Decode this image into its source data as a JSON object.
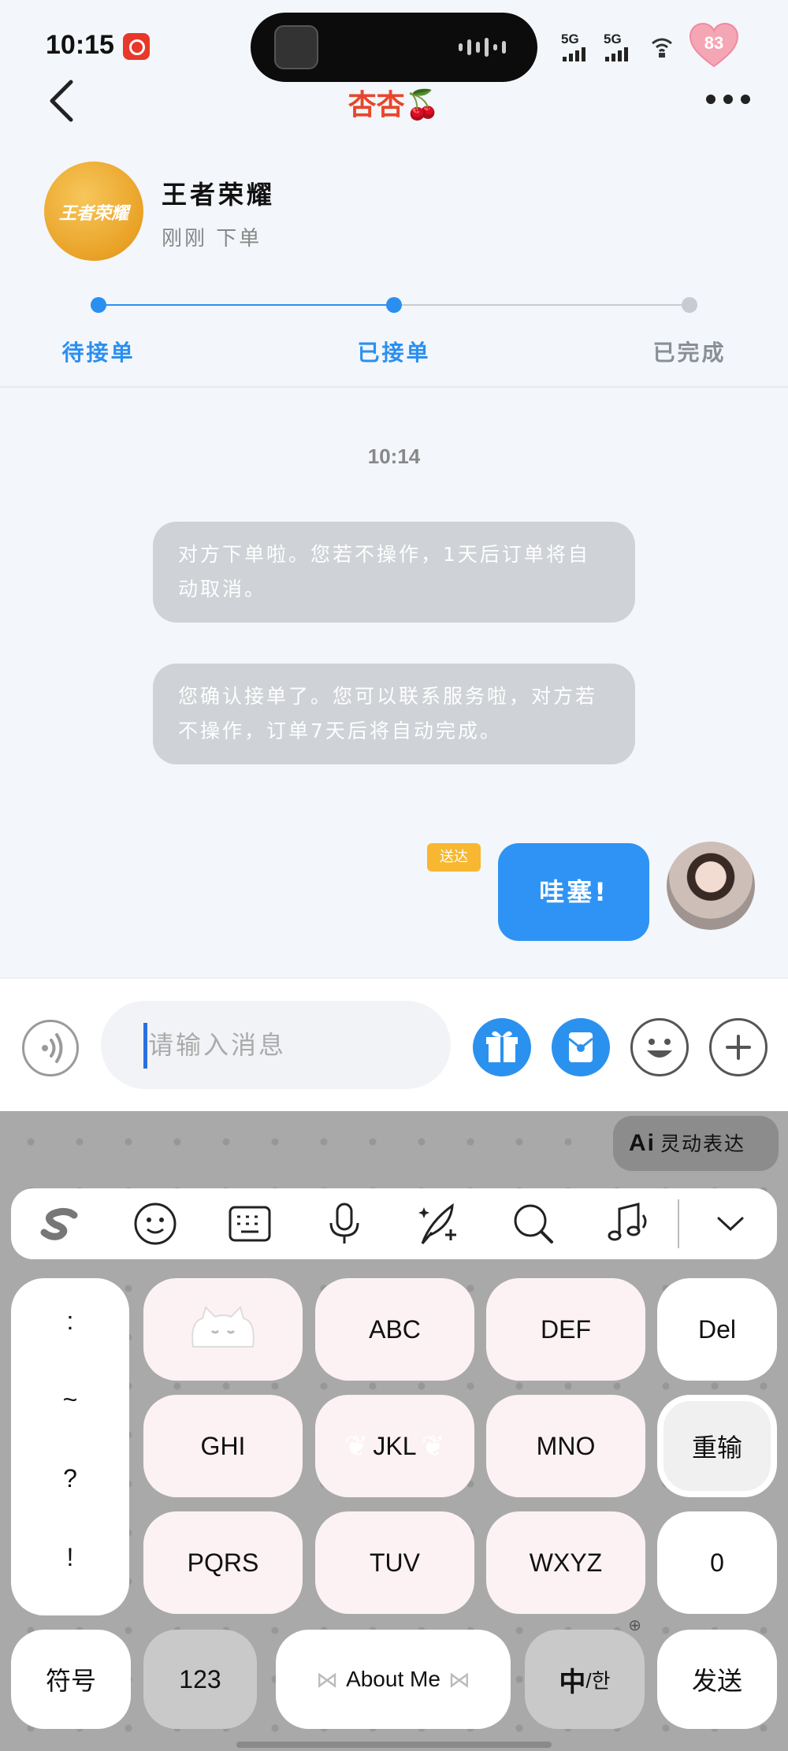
{
  "status_bar": {
    "time": "10:15",
    "signal1": "5G",
    "signal2": "5G",
    "battery": "83"
  },
  "header": {
    "title": "杏杏🍒"
  },
  "order": {
    "game_name": "王者荣耀",
    "game_logo_text": "王者荣耀",
    "order_time": "刚刚 下单",
    "steps": [
      {
        "label": "待接单",
        "state": "done"
      },
      {
        "label": "已接单",
        "state": "current"
      },
      {
        "label": "已完成",
        "state": "pending"
      }
    ]
  },
  "chat": {
    "timestamp": "10:14",
    "system_messages": [
      "对方下单啦。您若不操作，1天后订单将自动取消。",
      "您确认接单了。您可以联系服务啦，对方若不操作，订单7天后将自动完成。"
    ],
    "my_message": {
      "text": "哇塞!",
      "status": "送达"
    }
  },
  "input_bar": {
    "placeholder": "请输入消息"
  },
  "keyboard": {
    "ai_chip_prefix": "Ai",
    "ai_chip_label": "灵动表达",
    "punct": [
      ":",
      "~",
      "?",
      "!"
    ],
    "row1": [
      "ABC",
      "DEF"
    ],
    "del": "Del",
    "row2": [
      "GHI",
      "JKL",
      "MNO"
    ],
    "reenter": "重输",
    "row3": [
      "PQRS",
      "TUV",
      "WXYZ"
    ],
    "zero": "0",
    "symbols": "符号",
    "num": "123",
    "space": "About Me",
    "lang_main": "中",
    "lang_alt": "/한",
    "send": "发送"
  },
  "colors": {
    "accent_blue": "#2e93f4",
    "title_red": "#e8462c",
    "bubble_grey": "#cfd2d6",
    "delivered_badge": "#f7b731"
  }
}
